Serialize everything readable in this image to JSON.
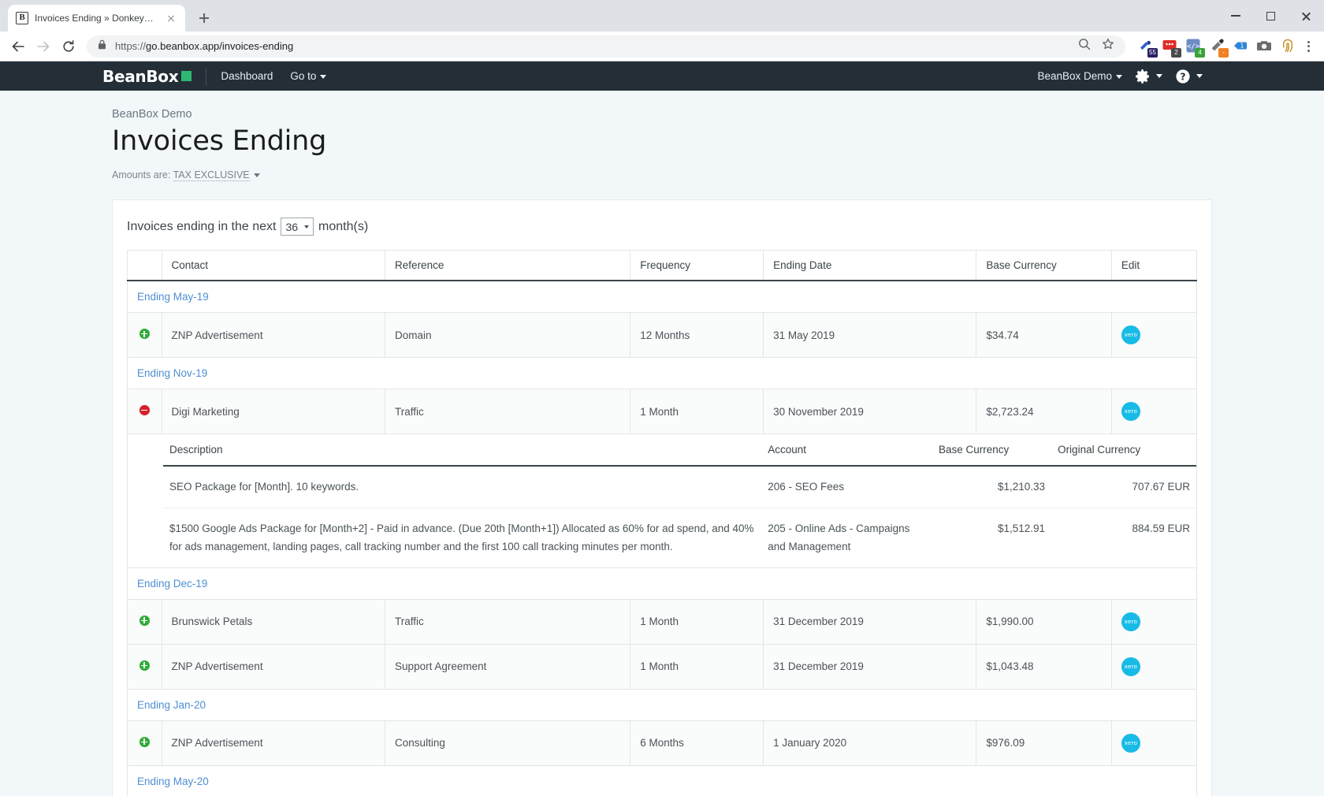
{
  "browser": {
    "tab": {
      "favicon": "b-logo-icon",
      "title": "Invoices Ending » DonkeyBean"
    },
    "address": {
      "scheme": "https://",
      "host_path": "go.beanbox.app/invoices-ending",
      "full": "https://go.beanbox.app/invoices-ending"
    },
    "extensions": [
      {
        "name": "lastpass-extension",
        "badge": "55",
        "badge_color": "#2b1e66"
      },
      {
        "name": "notifications-extension",
        "badge": "2",
        "badge_color": "#4a4a4a"
      },
      {
        "name": "code-extension",
        "badge": "4",
        "badge_color": "#3aa33a"
      },
      {
        "name": "eyedropper-extension",
        "badge": "-",
        "badge_color": "#f08124"
      },
      {
        "name": "tag-extension",
        "badge": "",
        "badge_color": ""
      },
      {
        "name": "screenshot-camera-extension",
        "badge": "",
        "badge_color": ""
      },
      {
        "name": "fingerprint-extension",
        "badge": "",
        "badge_color": ""
      }
    ],
    "window_controls": [
      "minimize",
      "maximize",
      "close"
    ]
  },
  "appnav": {
    "brand": "BeanBox",
    "links": [
      {
        "label": "Dashboard",
        "dropdown": false
      },
      {
        "label": "Go to",
        "dropdown": true
      }
    ],
    "org": {
      "label": "BeanBox Demo",
      "dropdown": true
    },
    "settings_icon": "gear-icon",
    "help_icon": "question-mark-icon"
  },
  "header": {
    "breadcrumb": "BeanBox Demo",
    "title": "Invoices Ending",
    "amounts_prefix": "Amounts are:",
    "amounts_value": "TAX EXCLUSIVE"
  },
  "card": {
    "lead_before": "Invoices ending in the next",
    "months_value": "36",
    "lead_after": "month(s)",
    "columns": [
      "",
      "Contact",
      "Reference",
      "Frequency",
      "Ending Date",
      "Base Currency",
      "Edit"
    ],
    "detail_columns": [
      "Description",
      "Account",
      "Base Currency",
      "Original Currency"
    ],
    "groups": [
      {
        "label": "Ending May-19",
        "rows": [
          {
            "state": "collapsed",
            "contact": "ZNP Advertisement",
            "reference": "Domain",
            "frequency": "12 Months",
            "ending_date": "31 May 2019",
            "base_currency": "$34.74",
            "edit_badge": "xero",
            "details": []
          }
        ]
      },
      {
        "label": "Ending Nov-19",
        "rows": [
          {
            "state": "expanded",
            "contact": "Digi Marketing",
            "reference": "Traffic",
            "frequency": "1 Month",
            "ending_date": "30 November 2019",
            "base_currency": "$2,723.24",
            "edit_badge": "xero",
            "details": [
              {
                "description": "SEO Package for [Month]. 10 keywords.",
                "account": "206 - SEO Fees",
                "base_currency": "$1,210.33",
                "original_currency": "707.67 EUR"
              },
              {
                "description": "$1500 Google Ads Package for [Month+2] - Paid in advance. (Due 20th [Month+1]) Allocated as 60% for ad spend, and 40% for ads management, landing pages, call tracking number and the first 100 call tracking minutes per month.",
                "account": "205 - Online Ads - Campaigns and Management",
                "base_currency": "$1,512.91",
                "original_currency": "884.59 EUR"
              }
            ]
          }
        ]
      },
      {
        "label": "Ending Dec-19",
        "rows": [
          {
            "state": "collapsed",
            "contact": "Brunswick Petals",
            "reference": "Traffic",
            "frequency": "1 Month",
            "ending_date": "31 December 2019",
            "base_currency": "$1,990.00",
            "edit_badge": "xero",
            "details": []
          },
          {
            "state": "collapsed",
            "contact": "ZNP Advertisement",
            "reference": "Support Agreement",
            "frequency": "1 Month",
            "ending_date": "31 December 2019",
            "base_currency": "$1,043.48",
            "edit_badge": "xero",
            "details": []
          }
        ]
      },
      {
        "label": "Ending Jan-20",
        "rows": [
          {
            "state": "collapsed",
            "contact": "ZNP Advertisement",
            "reference": "Consulting",
            "frequency": "6 Months",
            "ending_date": "1 January 2020",
            "base_currency": "$976.09",
            "edit_badge": "xero",
            "details": []
          }
        ]
      },
      {
        "label": "Ending May-20",
        "rows": []
      }
    ]
  },
  "colors": {
    "nav_bg": "#242e37",
    "brand_green": "#2eb872",
    "page_bg": "#f2f7f9",
    "link_blue": "#4e8fd4",
    "xero_blue": "#18bbe6",
    "expand_green": "#2faa37",
    "collapse_red": "#d3202a"
  }
}
